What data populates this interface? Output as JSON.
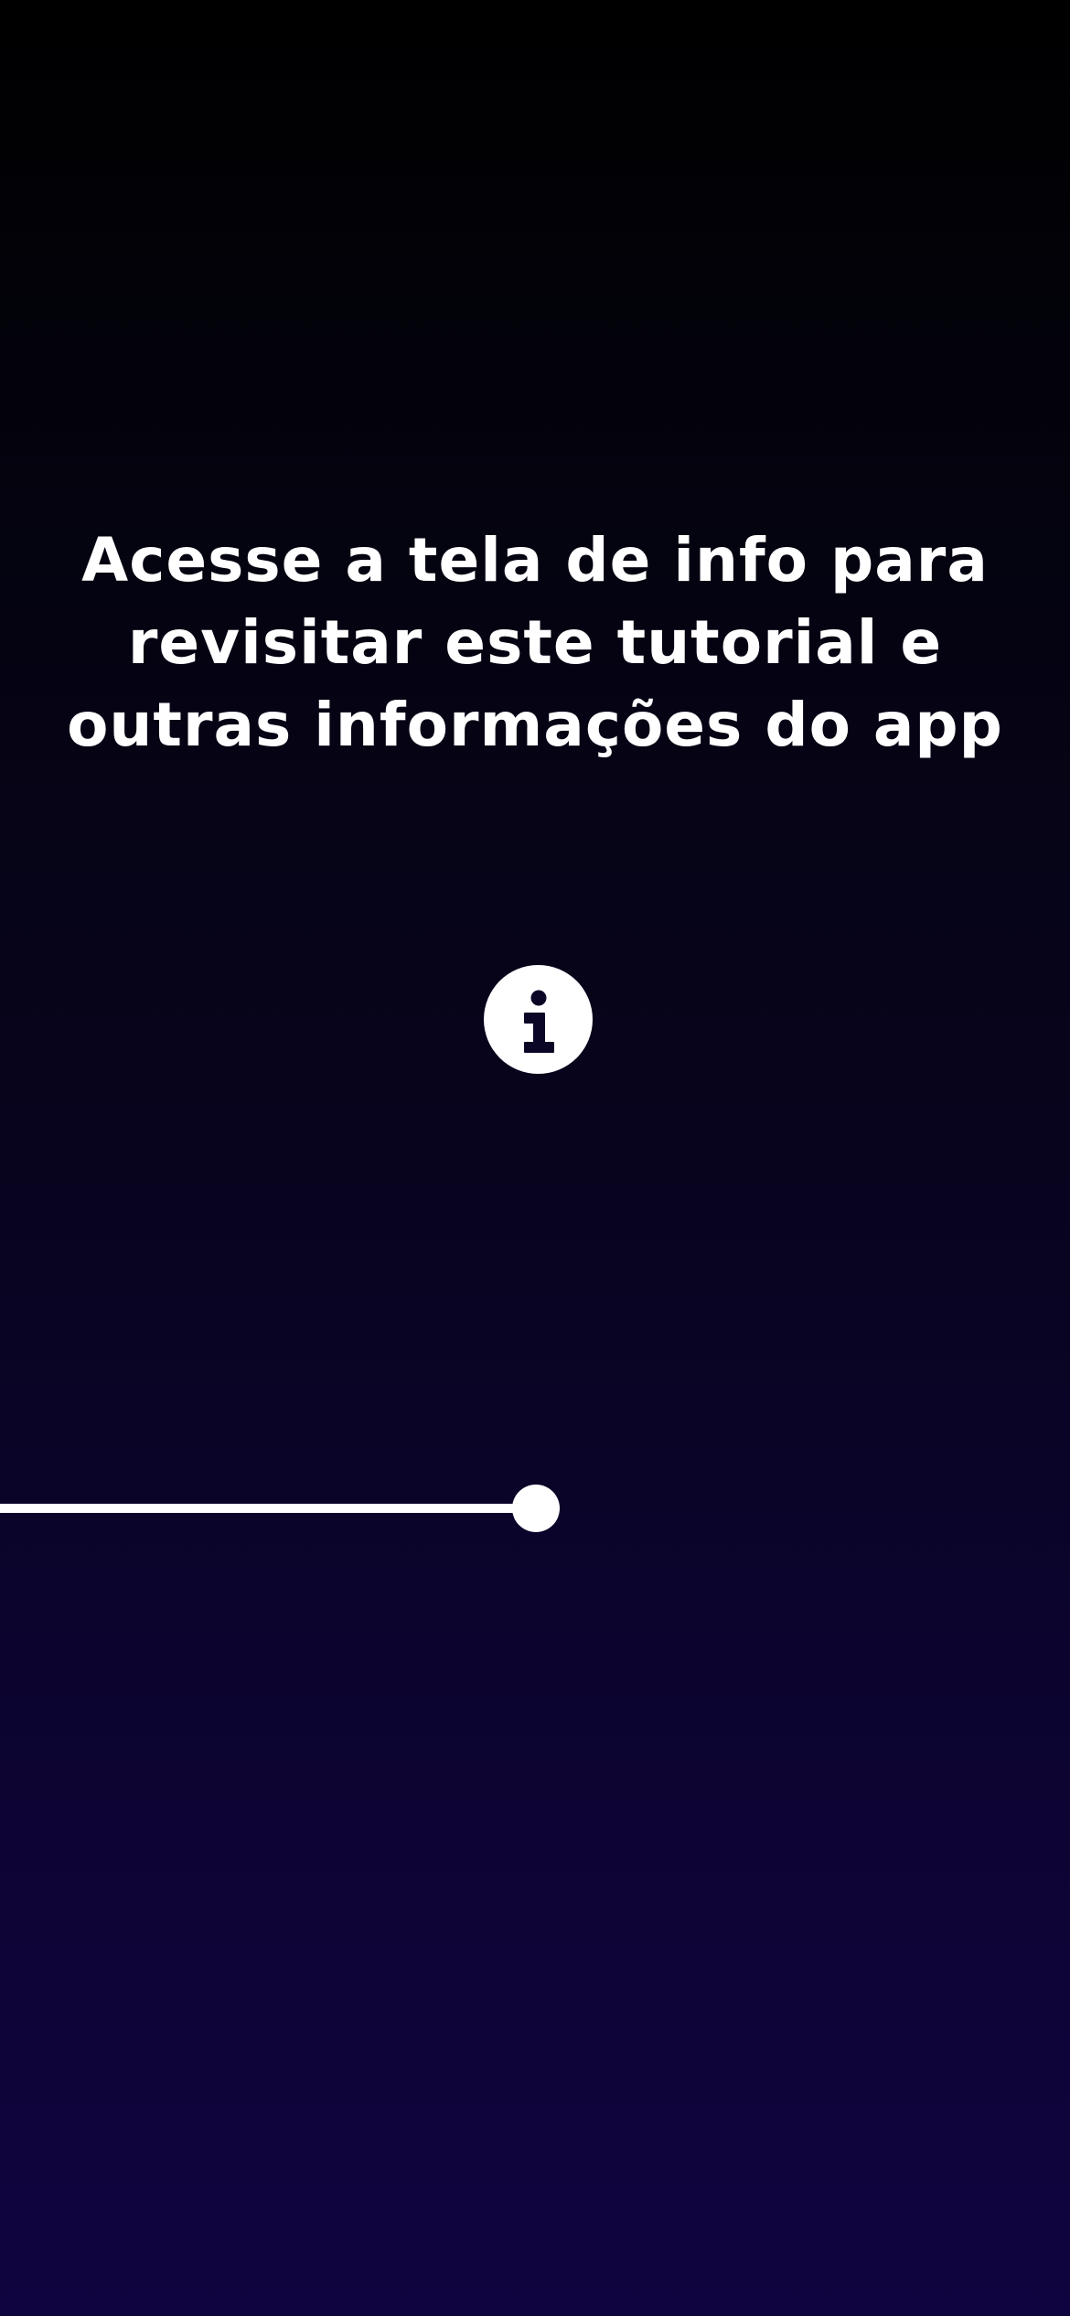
{
  "tutorial": {
    "message_lines": [
      "Acesse a tela de info para",
      "revisitar este tutorial e",
      "outras informações do app"
    ],
    "info_button": {
      "icon": "info-icon"
    },
    "progress": {
      "value": 0.5
    }
  },
  "colors": {
    "background_top": "#000000",
    "background_bottom": "#100440",
    "foreground": "#ffffff",
    "icon_glyph": "#0b0526"
  }
}
